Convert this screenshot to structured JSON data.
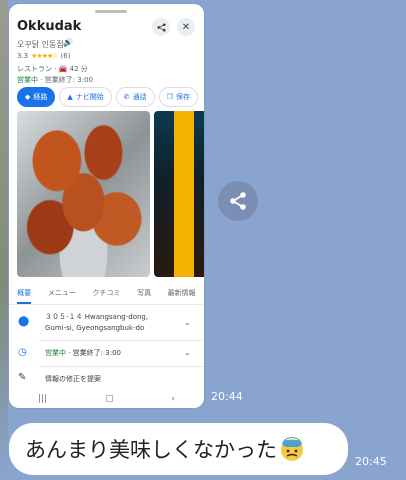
{
  "maps_card": {
    "title": "Okkudak",
    "korean_name": "오꾸닭 인동점",
    "rating": "3.3",
    "stars": "★★★★☆",
    "review_count": "(6)",
    "category": "レストラン · 🚘 42 分",
    "open_status": "営業中",
    "closing": " · 営業終了: 3:00",
    "actions": [
      {
        "label": "経路",
        "icon": "directions-icon"
      },
      {
        "label": "ナビ開始",
        "icon": "navigation-icon"
      },
      {
        "label": "通話",
        "icon": "phone-icon"
      },
      {
        "label": "保存",
        "icon": "bookmark-icon"
      }
    ],
    "tabs": [
      "概要",
      "メニュー",
      "クチコミ",
      "写真",
      "最新情報"
    ],
    "address_line1": "３０５-１４ Hwangsang-dong,",
    "address_line2": "Gumi-si, Gyeongsangbuk-do",
    "hours_status": "営業中",
    "hours_closing": " · 営業終了: 3:00",
    "suggest_edit": "情報の修正を提案"
  },
  "chat": {
    "time_1": "20:44",
    "time_2": "20:45",
    "message": "あんまり美味しくなかった"
  },
  "colors": {
    "chat_background": "#8aa4d0",
    "accent_blue": "#1a73e8",
    "open_green": "#188038",
    "star_color": "#f9ab00"
  }
}
